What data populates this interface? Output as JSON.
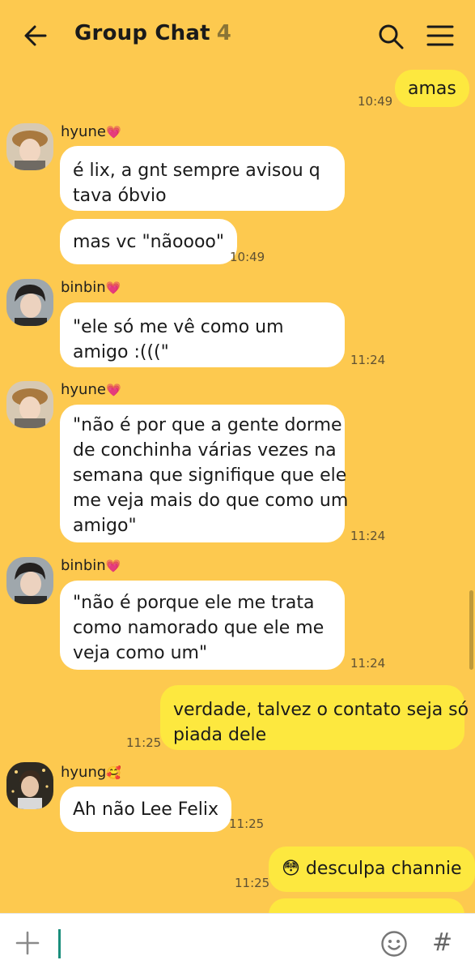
{
  "header": {
    "title": "Group Chat",
    "member_count": "4",
    "back_icon": "arrow-left-icon",
    "search_icon": "search-icon",
    "menu_icon": "hamburger-menu-icon"
  },
  "messages": [
    {
      "direction": "out",
      "text": "amas",
      "time": "10:49"
    },
    {
      "direction": "in",
      "sender": "hyune",
      "sender_emoji": "💗",
      "text": "é lix, a gnt sempre avisou q\ntava óbvio",
      "time": ""
    },
    {
      "direction": "in",
      "text": "mas vc \"nãoooo\"",
      "time": "10:49"
    },
    {
      "direction": "in",
      "sender": "binbin",
      "sender_emoji": "💗",
      "text": "\"ele só me vê como um\namigo :(((\"",
      "time": "11:24"
    },
    {
      "direction": "in",
      "sender": "hyune",
      "sender_emoji": "💗",
      "text": "\"não é por que a gente dorme\nde conchinha várias vezes na\nsemana que signifique que ele\nme veja mais do que como um\namigo\"",
      "time": "11:24"
    },
    {
      "direction": "in",
      "sender": "binbin",
      "sender_emoji": "💗",
      "text": "\"não é porque ele me trata\ncomo namorado que ele me\nveja como um\"",
      "time": "11:24"
    },
    {
      "direction": "out",
      "text": "verdade, talvez o contato seja só\npiada dele",
      "time": "11:25"
    },
    {
      "direction": "in",
      "sender": "hyung",
      "sender_emoji": "🥰",
      "text": "Ah não Lee Felix",
      "time": "11:25"
    },
    {
      "direction": "out",
      "text": "😳 desculpa channie",
      "time": "11:25"
    }
  ],
  "input_bar": {
    "plus_icon": "plus-icon",
    "emoji_icon": "emoji-smile-icon",
    "hash_label": "#"
  },
  "colors": {
    "background": "#fdc94f",
    "incoming_bubble": "#ffffff",
    "outgoing_bubble": "#fde83f"
  }
}
